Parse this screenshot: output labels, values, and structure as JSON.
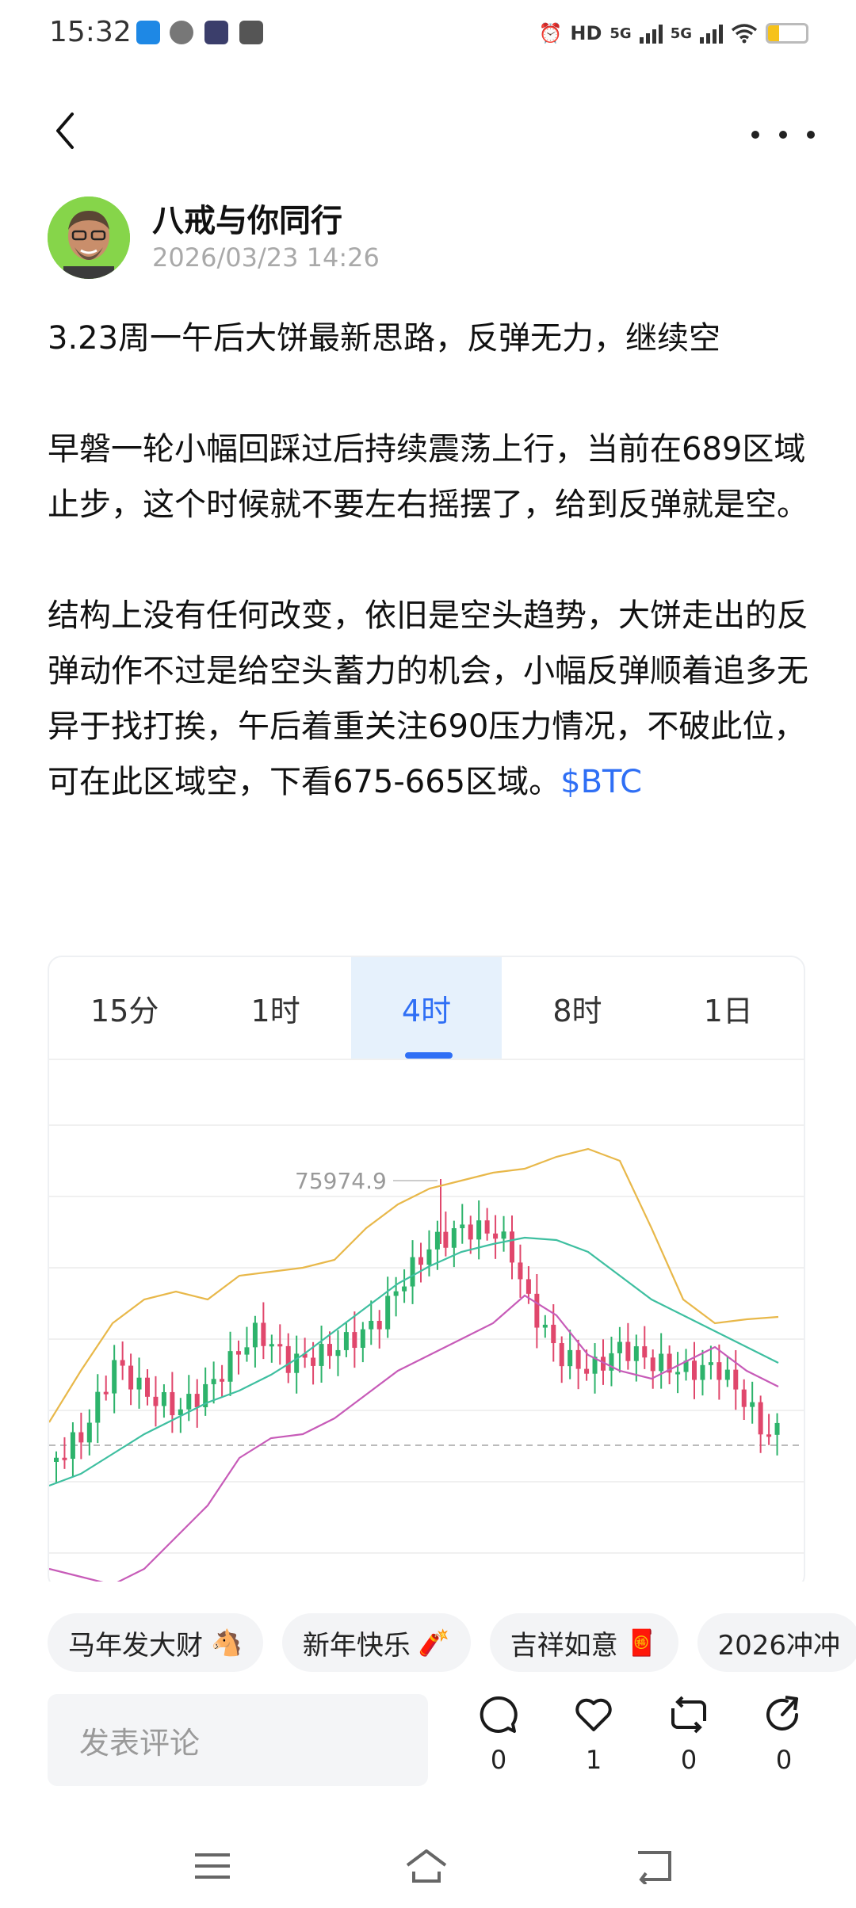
{
  "status_bar": {
    "time": "15:32",
    "hd_label": "HD",
    "network_1": "5G",
    "network_2": "5G",
    "battery_level": 0.3,
    "battery_color": "#f6c21a",
    "app_icons": [
      "bilibili-icon",
      "browser-icon",
      "player-icon",
      "message-icon"
    ]
  },
  "header": {
    "back_icon": "chevron-left-icon",
    "more_icon": "more-dots-icon"
  },
  "author": {
    "name": "八戒与你同行",
    "time": "2026/03/23 14:26"
  },
  "post": {
    "title": "3.23周一午后大饼最新思路，反弹无力，继续空",
    "paragraph_1": "早磐一轮小幅回踩过后持续震荡上行，当前在689区域止步，这个时候就不要左右摇摆了，给到反弹就是空。",
    "paragraph_2": "结构上没有任何改变，依旧是空头趋势，大饼走出的反弹动作不过是给空头蓄力的机会，小幅反弹顺着追多无异于找打挨，午后着重关注690压力情况，不破此位，可在此区域空，下看675-665区域。",
    "ticker": "$BTC"
  },
  "chart": {
    "tabs": [
      "15分",
      "1时",
      "4时",
      "8时",
      "1日"
    ],
    "active_tab": 2,
    "accent": "#2f6ff5",
    "up_color": "#2db36b",
    "down_color": "#e0476c",
    "high_label": "75974.9"
  },
  "chart_data": {
    "type": "candlestick",
    "high_annotation": "75974.9",
    "series": [
      {
        "name": "",
        "color": "#e8b84a",
        "kind": "upper-band"
      },
      {
        "name": "",
        "color": "#3ebfa0",
        "kind": "middle-band"
      },
      {
        "name": "",
        "color": "#c75bb8",
        "kind": "lower-band"
      }
    ],
    "candle_count": 88,
    "trend": "rise to peak then decline"
  },
  "topics": [
    {
      "label": "马年发大财",
      "emoji": "🐴"
    },
    {
      "label": "新年快乐",
      "emoji": "🧨"
    },
    {
      "label": "吉祥如意",
      "emoji": "🧧"
    },
    {
      "label": "2026冲冲",
      "emoji": ""
    }
  ],
  "comment": {
    "placeholder": "发表评论"
  },
  "actions": {
    "comments": "0",
    "likes": "1",
    "reposts": "0",
    "shares": "0"
  }
}
